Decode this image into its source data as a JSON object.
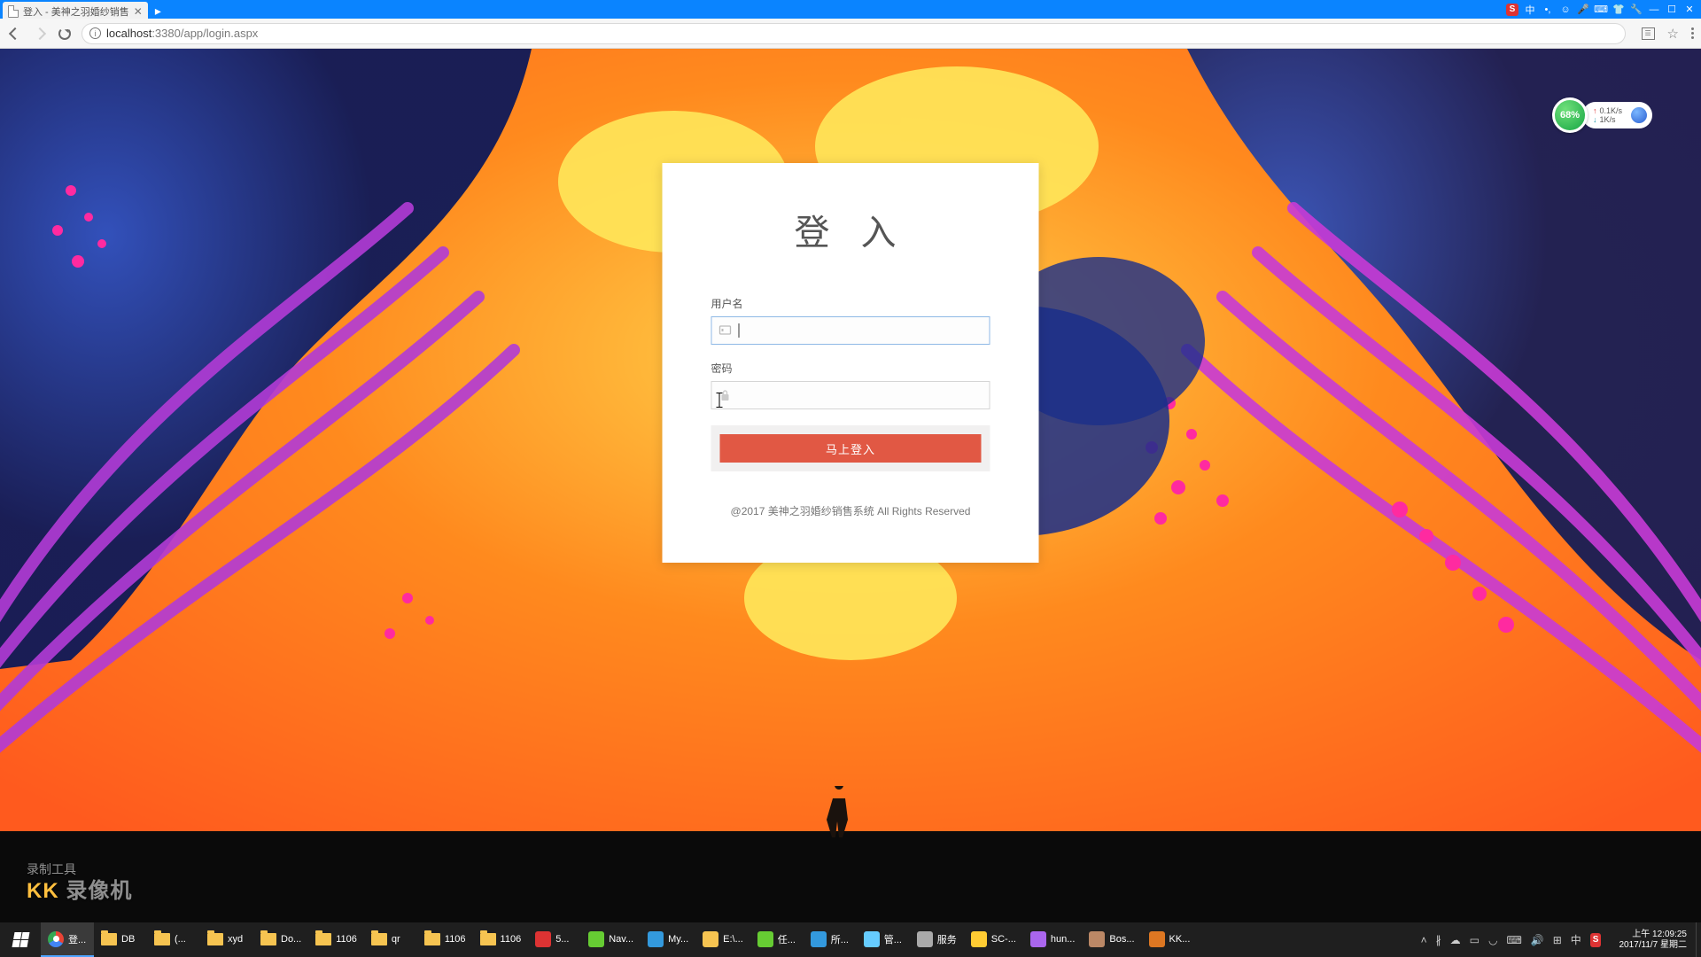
{
  "window": {
    "tab_title": "登入 - 美神之羽婚纱销售",
    "win_min": "—",
    "win_max": "☐",
    "win_close": "✕"
  },
  "ime": {
    "logo": "S",
    "lang": "中"
  },
  "browser": {
    "host": "localhost",
    "port": ":3380",
    "path": "/app/login.aspx"
  },
  "netwidget": {
    "percent": "68%",
    "up": "0.1K/s",
    "down": "1K/s"
  },
  "login": {
    "title": "登 入",
    "username_label": "用户名",
    "password_label": "密码",
    "username_value": "",
    "password_value": "",
    "button": "马上登入",
    "copyright": "@2017 美神之羽婚纱销售系统 All Rights Reserved"
  },
  "watermark": {
    "line1": "录制工具",
    "brand_a": "KK",
    "brand_b": " 录像机"
  },
  "taskbar": {
    "items": [
      {
        "label": "登...",
        "color": "#fff",
        "icon": "chrome",
        "active": true
      },
      {
        "label": "DB",
        "icon": "folder"
      },
      {
        "label": "(...",
        "icon": "folder"
      },
      {
        "label": "xyd",
        "icon": "folder"
      },
      {
        "label": "Do...",
        "icon": "folder"
      },
      {
        "label": "1106",
        "icon": "folder"
      },
      {
        "label": "qr",
        "icon": "folder"
      },
      {
        "label": "1106",
        "icon": "folder"
      },
      {
        "label": "1106",
        "icon": "folder"
      },
      {
        "label": "5...",
        "icon": "music",
        "color": "#d33"
      },
      {
        "label": "Nav...",
        "icon": "nav",
        "color": "#6c3"
      },
      {
        "label": "My...",
        "icon": "mysql",
        "color": "#39d"
      },
      {
        "label": "E:\\...",
        "icon": "explorer",
        "color": "#f6c451"
      },
      {
        "label": "任...",
        "icon": "task",
        "color": "#6c3"
      },
      {
        "label": "所...",
        "icon": "ppt",
        "color": "#39d"
      },
      {
        "label": "管...",
        "icon": "iis",
        "color": "#6cf"
      },
      {
        "label": "服务",
        "icon": "gear",
        "color": "#aaa"
      },
      {
        "label": "SC-...",
        "icon": "sql",
        "color": "#fc3"
      },
      {
        "label": "hun...",
        "icon": "vs",
        "color": "#a6e"
      },
      {
        "label": "Bos...",
        "icon": "boss",
        "color": "#b86"
      },
      {
        "label": "KK...",
        "icon": "kk",
        "color": "#d72"
      }
    ],
    "clock_time": "上午 12:09:25",
    "clock_date": "2017/11/7 星期二"
  }
}
